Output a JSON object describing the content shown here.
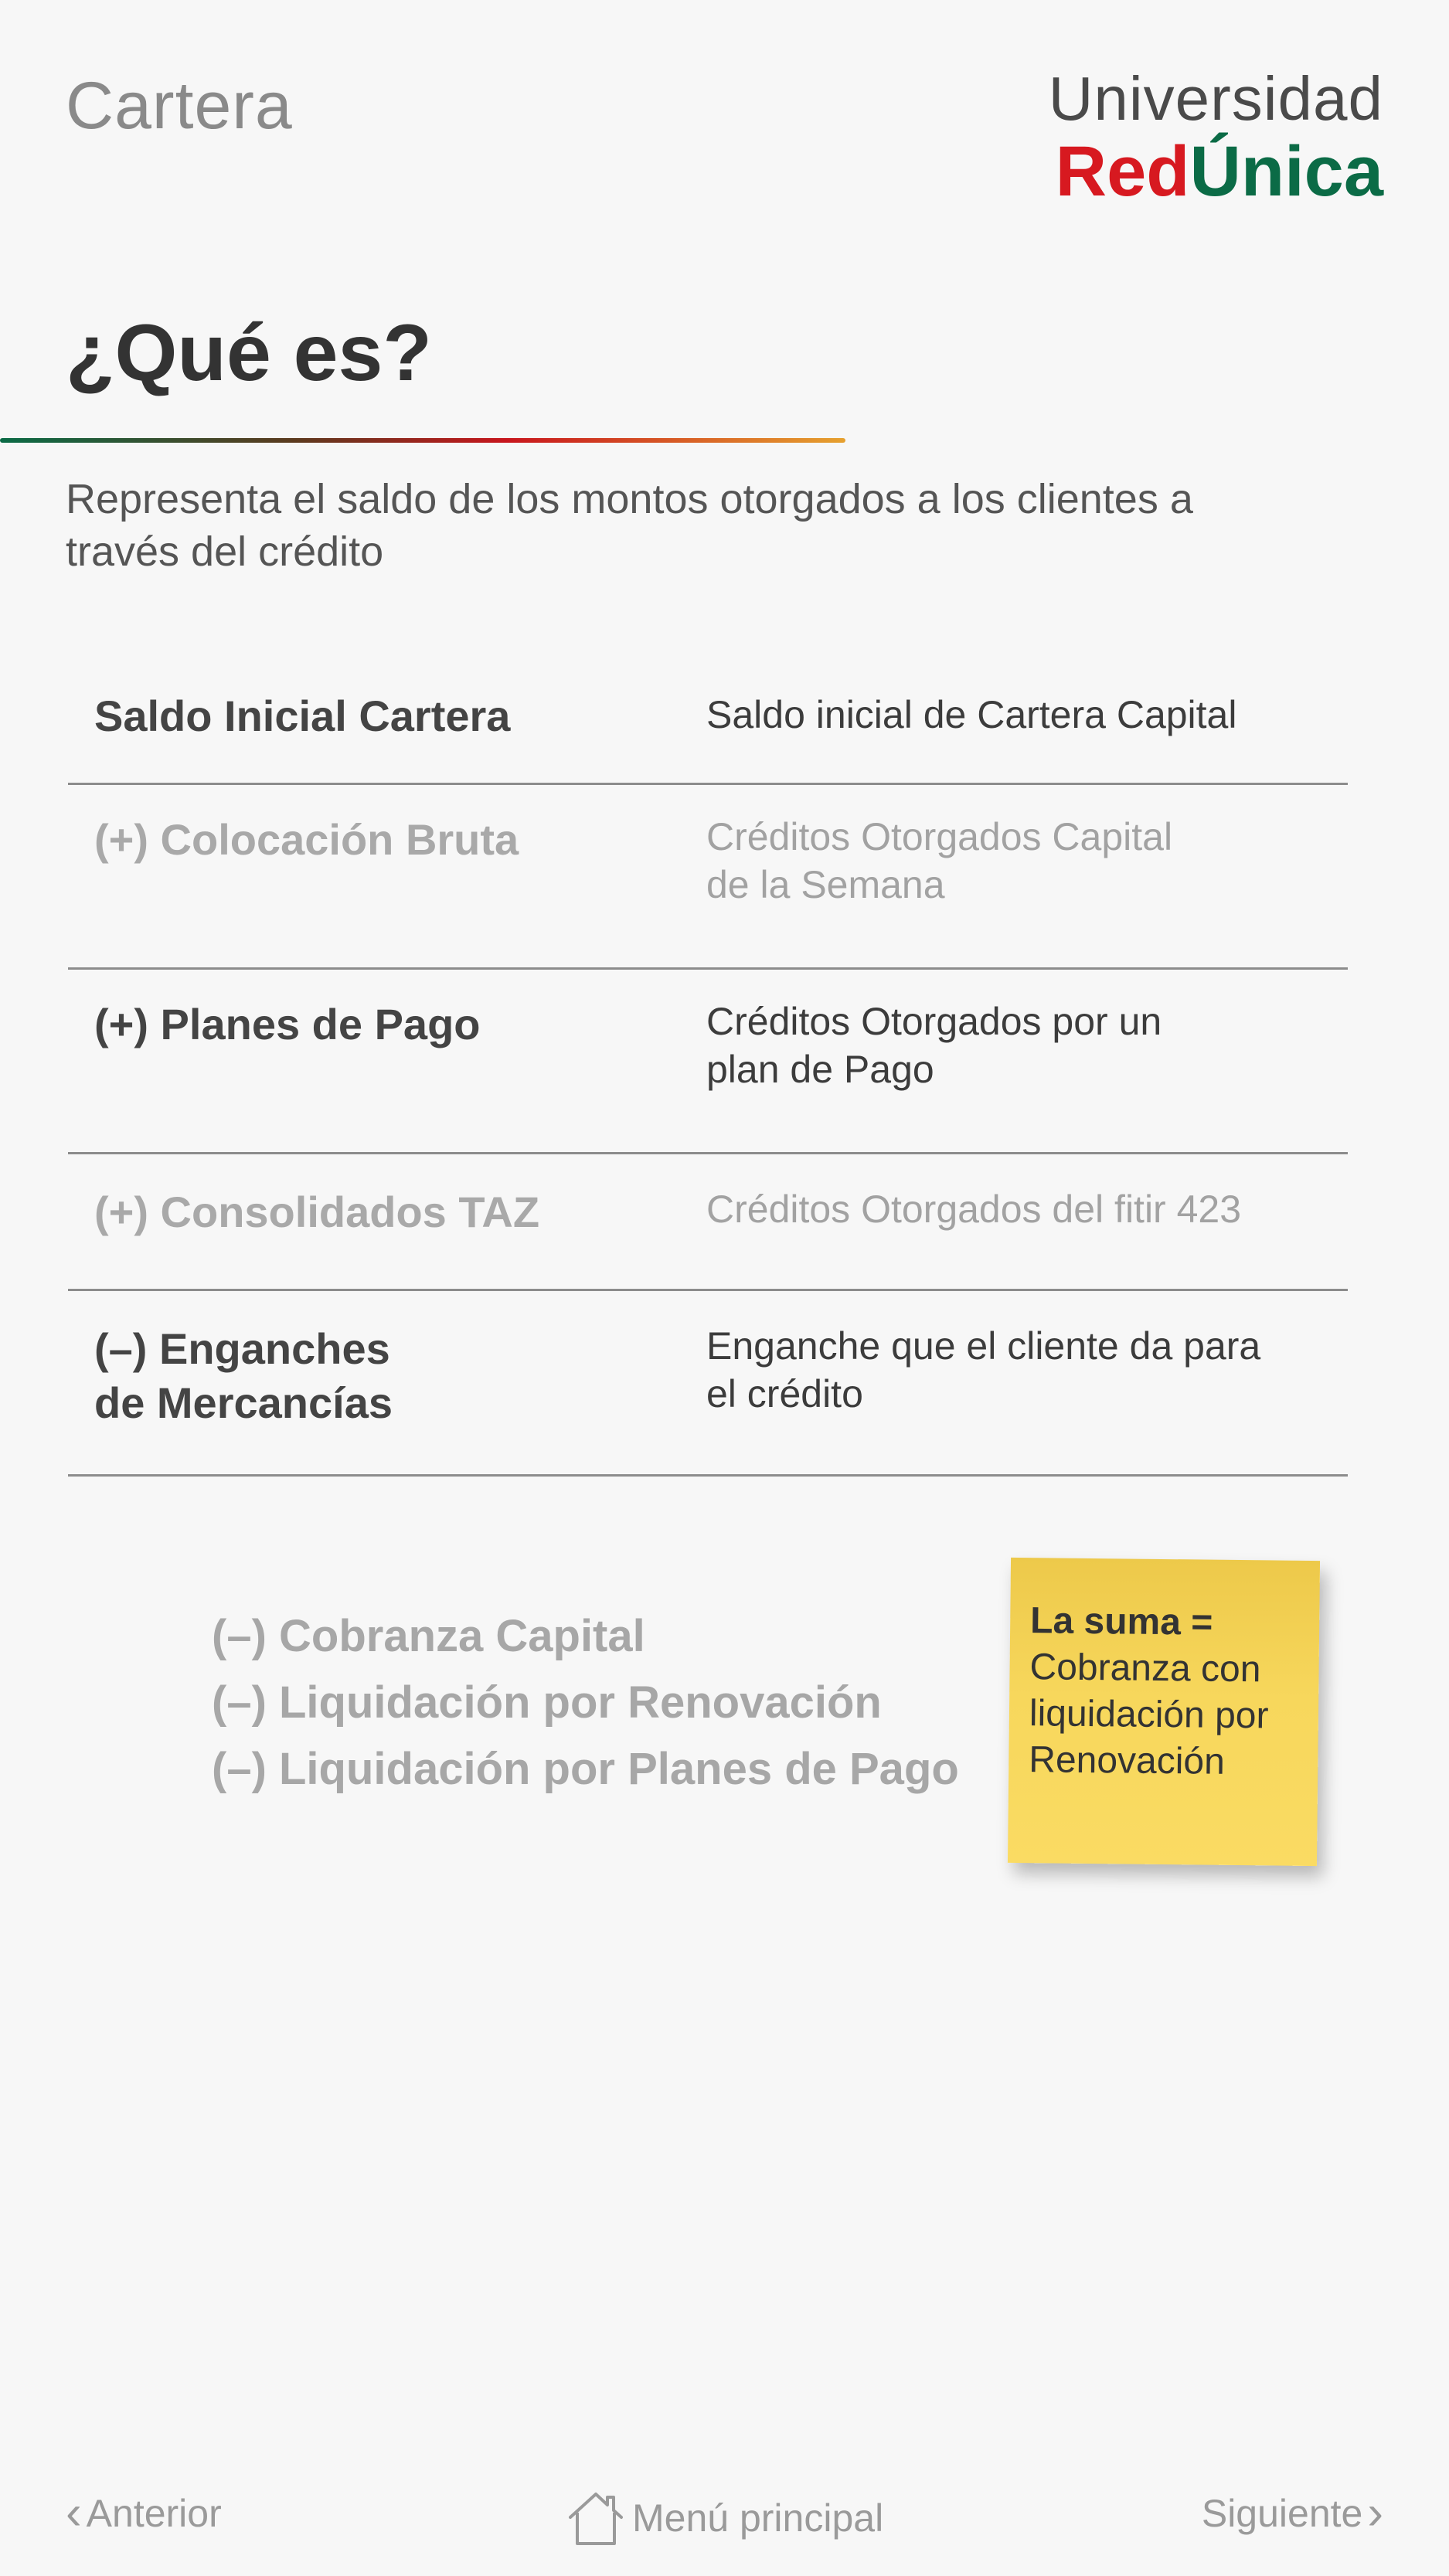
{
  "header": {
    "section_title": "Cartera",
    "logo": {
      "top_text": "Universidad",
      "red_text": "Red",
      "green_text": "Única"
    }
  },
  "main": {
    "question": "¿Qué es?",
    "definition": "Representa el saldo de los montos otorgados a los clientes a través del crédito"
  },
  "table": {
    "rows": [
      {
        "term": "Saldo Inicial Cartera",
        "description": "Saldo  inicial de Cartera Capital"
      },
      {
        "term": "(+) Colocación Bruta",
        "description": "Créditos Otorgados Capital de la Semana"
      },
      {
        "term": "(+) Planes de Pago",
        "description": "Créditos Otorgados por un plan de Pago"
      },
      {
        "term": "(+) Consolidados TAZ",
        "description": "Créditos Otorgados del fitir 423"
      },
      {
        "term": "(–) Enganches de Mercancías",
        "description": "Enganche que el cliente da para el crédito"
      }
    ]
  },
  "sub_list": {
    "items": [
      "(–) Cobranza Capital",
      "(–) Liquidación por Renovación",
      "(–) Liquidación por Planes de Pago"
    ]
  },
  "sticky_note": {
    "heading": "La suma =",
    "body": "Cobranza con liquidación por Renovación"
  },
  "footer": {
    "prev_label": "Anterior",
    "home_label": "Menú principal",
    "next_label": "Siguiente",
    "icons": {
      "prev": "chevron-left-icon",
      "home": "home-icon",
      "next": "chevron-right-icon"
    }
  },
  "colors": {
    "background": "#f7f7f7",
    "brand_red": "#d71920",
    "brand_green": "#0b6b46",
    "sticky_yellow": "#f7d75c"
  }
}
